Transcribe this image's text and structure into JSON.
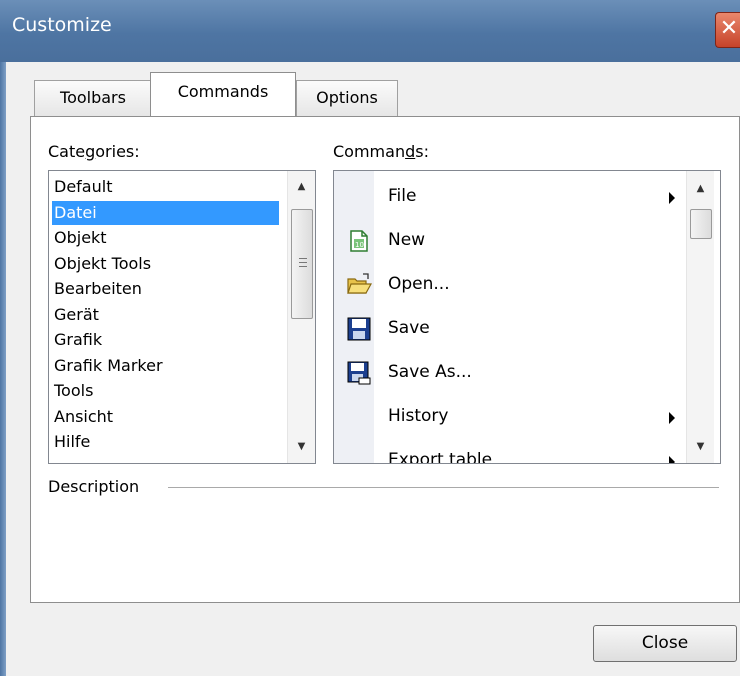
{
  "window": {
    "title": "Customize",
    "close_glyph": "✕"
  },
  "tabs": [
    {
      "label": "Toolbars",
      "active": false
    },
    {
      "label": "Commands",
      "active": true
    },
    {
      "label": "Options",
      "active": false
    }
  ],
  "categories": {
    "label_before": "Cate",
    "label_hotkey": "g",
    "label_after": "ories:",
    "selected_index": 1,
    "items": [
      "Default",
      "Datei",
      "Objekt",
      "Objekt Tools",
      "Bearbeiten",
      "Gerät",
      "Grafik",
      "Grafik Marker",
      "Tools",
      "Ansicht",
      "Hilfe"
    ]
  },
  "commands": {
    "label_before": "Comman",
    "label_hotkey": "d",
    "label_after": "s:",
    "items": [
      {
        "label": "File",
        "icon": "none",
        "submenu": true
      },
      {
        "label": "New",
        "icon": "new-document-icon",
        "submenu": false
      },
      {
        "label": "Open...",
        "icon": "open-folder-icon",
        "submenu": false
      },
      {
        "label": "Save",
        "icon": "floppy-disk-icon",
        "submenu": false
      },
      {
        "label": "Save As...",
        "icon": "save-as-icon",
        "submenu": false
      },
      {
        "label": "History",
        "icon": "none",
        "submenu": true
      },
      {
        "label": "Export table",
        "icon": "none",
        "submenu": true
      }
    ]
  },
  "description": {
    "label": "Description",
    "text": ""
  },
  "buttons": {
    "close": "Close"
  },
  "colors": {
    "titlebar": "#4e75a3",
    "selection": "#3399ff",
    "close_button": "#c6432a"
  }
}
